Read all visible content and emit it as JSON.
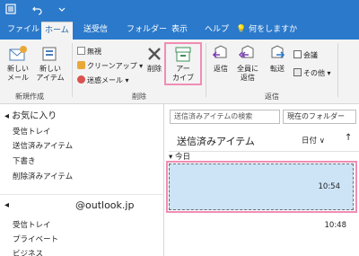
{
  "quick_access": {
    "app_icon": "outlook-app-icon",
    "undo_icon": "undo-icon",
    "customize_icon": "chevron-down-icon"
  },
  "tabs": [
    {
      "label": "ファイル"
    },
    {
      "label": "ホーム"
    },
    {
      "label": "送受信"
    },
    {
      "label": "フォルダー"
    },
    {
      "label": "表示"
    },
    {
      "label": "ヘルプ"
    }
  ],
  "tell_me": {
    "label": "何をしますか"
  },
  "ribbon": {
    "new": {
      "new_mail": "新しい\nメール",
      "new_items": "新しい\nアイテム",
      "group_label": "新規作成"
    },
    "delete": {
      "ignore": "無視",
      "cleanup": "クリーンアップ",
      "junk": "迷惑メール",
      "delete_btn": "削除",
      "archive": "アー\nカイブ",
      "group_label": "削除"
    },
    "respond": {
      "reply": "返信",
      "reply_all": "全員に\n返信",
      "forward": "転送",
      "meeting": "会議",
      "more": "その他",
      "group_label": "返信"
    }
  },
  "folder_pane": {
    "favorites_label": "お気に入り",
    "favorites": [
      "受信トレイ",
      "送信済みアイテム",
      "下書き",
      "削除済みアイテム"
    ],
    "account_email": "@outlook.jp",
    "account_folders": [
      "受信トレイ",
      "プライベート",
      "ビジネス"
    ]
  },
  "message_list": {
    "search_placeholder": "送信済みアイテムの検索",
    "scope": "現在のフォルダー",
    "title": "送信済みアイテム",
    "sort_by": "日付",
    "sort_dir": "↑",
    "group_today": "今日",
    "messages": [
      {
        "time": "10:54",
        "selected": true
      },
      {
        "time": "10:48",
        "selected": false
      }
    ]
  },
  "colors": {
    "title_bar": "#2b79cb",
    "highlight": "#f08db5",
    "selected_row": "#cde4f7"
  }
}
